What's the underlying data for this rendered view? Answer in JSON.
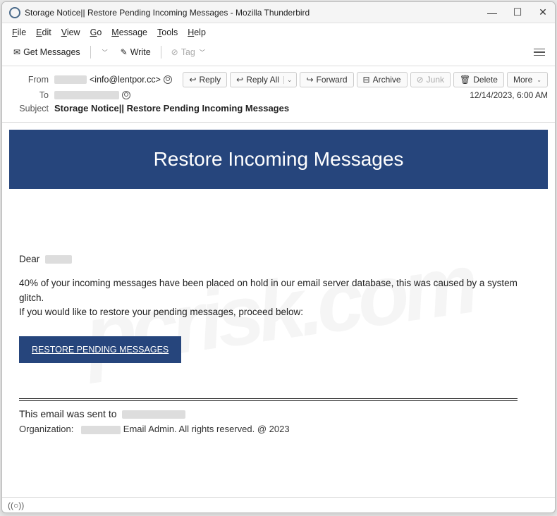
{
  "window": {
    "title": "Storage Notice|| Restore Pending Incoming Messages - Mozilla Thunderbird"
  },
  "menu": {
    "file": "File",
    "edit": "Edit",
    "view": "View",
    "go": "Go",
    "message": "Message",
    "tools": "Tools",
    "help": "Help"
  },
  "toolbar": {
    "get_messages": "Get Messages",
    "write": "Write",
    "tag": "Tag"
  },
  "headers": {
    "from_label": "From",
    "from_value": "<info@lentpor.cc>",
    "to_label": "To",
    "subject_label": "Subject",
    "subject_value": "Storage Notice|| Restore Pending Incoming Messages",
    "date": "12/14/2023, 6:00 AM"
  },
  "actions": {
    "reply": "Reply",
    "reply_all": "Reply All",
    "forward": "Forward",
    "archive": "Archive",
    "junk": "Junk",
    "delete": "Delete",
    "more": "More"
  },
  "email": {
    "banner": "Restore Incoming Messages",
    "greeting": "Dear",
    "body1": "40% of your incoming messages have been placed on hold in our email server database, this was caused by a system glitch.",
    "body2": "If you would like to restore your pending messages, proceed below:",
    "button": "RESTORE PENDING MESSAGES",
    "footer_sent": "This email was sent to",
    "footer_org_prefix": "Organization:",
    "footer_org_suffix": "Email Admin. All rights reserved. @ 2023"
  },
  "status": {
    "indicator": "((○))"
  }
}
